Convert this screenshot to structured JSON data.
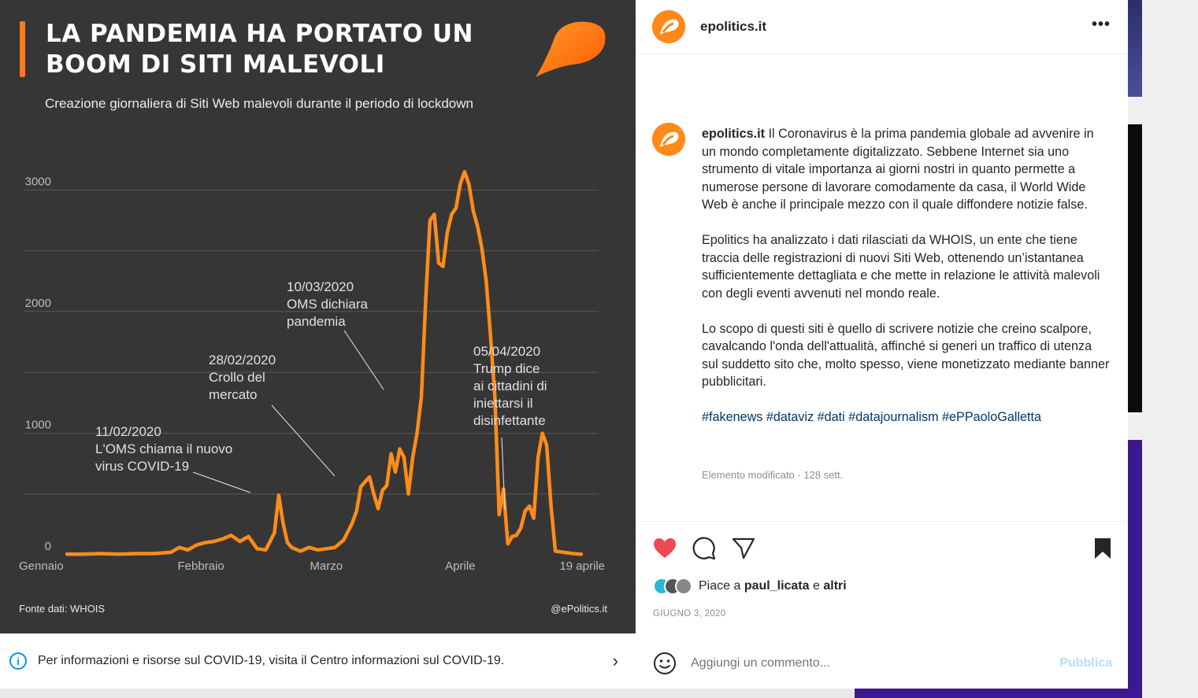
{
  "post": {
    "title_line1": "LA PANDEMIA HA PORTATO UN",
    "title_line2": "BOOM DI SITI MALEVOLI",
    "subtitle": "Creazione giornaliera di Siti Web malevoli durante il periodo di lockdown",
    "source": "Fonte dati: WHOIS",
    "handle": "@ePolitics.it",
    "accent_color": "#ff7a1a",
    "line_color": "#ff8c1a",
    "bg_color": "#363636"
  },
  "chart_data": {
    "type": "line",
    "title": "LA PANDEMIA HA PORTATO UN BOOM DI SITI MALEVOLI",
    "subtitle": "Creazione giornaliera di Siti Web malevoli durante il periodo di lockdown",
    "xlabel": "",
    "ylabel": "",
    "ylim": [
      0,
      3300
    ],
    "y_ticks": [
      0,
      1000,
      2000,
      3000
    ],
    "y_tick_labels": [
      "0",
      "1000",
      "2000",
      "3000"
    ],
    "x_ticks": [
      {
        "label": "Gennaio",
        "day": 0
      },
      {
        "label": "Febbraio",
        "day": 31
      },
      {
        "label": "Marzo",
        "day": 60
      },
      {
        "label": "Aprile",
        "day": 91
      },
      {
        "label": "19 aprile",
        "day": 109
      }
    ],
    "grid": true,
    "series": [
      {
        "values": [
          [
            0,
            5
          ],
          [
            4,
            5
          ],
          [
            8,
            10
          ],
          [
            12,
            5
          ],
          [
            16,
            10
          ],
          [
            20,
            10
          ],
          [
            24,
            20
          ],
          [
            26,
            60
          ],
          [
            28,
            40
          ],
          [
            30,
            80
          ],
          [
            32,
            100
          ],
          [
            34,
            110
          ],
          [
            36,
            130
          ],
          [
            38,
            160
          ],
          [
            40,
            110
          ],
          [
            42,
            150
          ],
          [
            44,
            50
          ],
          [
            46,
            40
          ],
          [
            48,
            180
          ],
          [
            49,
            490
          ],
          [
            50,
            260
          ],
          [
            51,
            100
          ],
          [
            52,
            60
          ],
          [
            54,
            30
          ],
          [
            56,
            60
          ],
          [
            58,
            40
          ],
          [
            60,
            50
          ],
          [
            62,
            60
          ],
          [
            64,
            120
          ],
          [
            66,
            260
          ],
          [
            67,
            360
          ],
          [
            68,
            560
          ],
          [
            69,
            600
          ],
          [
            70,
            640
          ],
          [
            71,
            500
          ],
          [
            72,
            380
          ],
          [
            73,
            530
          ],
          [
            74,
            570
          ],
          [
            75,
            830
          ],
          [
            76,
            680
          ],
          [
            77,
            870
          ],
          [
            78,
            800
          ],
          [
            79,
            500
          ],
          [
            80,
            800
          ],
          [
            81,
            1000
          ],
          [
            82,
            1300
          ],
          [
            83,
            2100
          ],
          [
            84,
            2750
          ],
          [
            85,
            2800
          ],
          [
            86,
            2400
          ],
          [
            87,
            2370
          ],
          [
            88,
            2650
          ],
          [
            89,
            2800
          ],
          [
            90,
            2850
          ],
          [
            91,
            3050
          ],
          [
            92,
            3150
          ],
          [
            93,
            3050
          ],
          [
            94,
            2830
          ],
          [
            95,
            2700
          ],
          [
            96,
            2520
          ],
          [
            97,
            2250
          ],
          [
            98,
            1800
          ],
          [
            99,
            1300
          ],
          [
            100,
            330
          ],
          [
            101,
            540
          ],
          [
            102,
            90
          ],
          [
            103,
            150
          ],
          [
            104,
            160
          ],
          [
            105,
            220
          ],
          [
            106,
            360
          ],
          [
            107,
            400
          ],
          [
            108,
            300
          ],
          [
            109,
            800
          ],
          [
            110,
            1000
          ],
          [
            111,
            900
          ],
          [
            112,
            400
          ],
          [
            113,
            30
          ],
          [
            115,
            20
          ],
          [
            117,
            10
          ],
          [
            119,
            5
          ]
        ]
      }
    ],
    "annotations": [
      {
        "date": "11/02/2020",
        "text_line1": "L'OMS chiama il nuovo",
        "text_line2": "virus COVID-19",
        "text_line3": ""
      },
      {
        "date": "28/02/2020",
        "text_line1": "Crollo del",
        "text_line2": "mercato",
        "text_line3": ""
      },
      {
        "date": "10/03/2020",
        "text_line1": "OMS dichiara",
        "text_line2": "pandemia",
        "text_line3": ""
      },
      {
        "date": "05/04/2020",
        "text_line1": "Trump dice",
        "text_line2": "ai cittadini di",
        "text_line3": "iniettarsi il",
        "text_line4": "disinfettante"
      }
    ]
  },
  "covid_bar": {
    "text": "Per informazioni e risorse sul COVID-19, visita il Centro informazioni sul COVID-19.",
    "info_icon": "info-icon",
    "chevron_icon": "chevron-right-icon"
  },
  "header": {
    "username": "epolitics.it",
    "more_label": "•••"
  },
  "caption": {
    "username": "epolitics.it",
    "para1": "Il Coronavirus è la prima pandemia globale ad avvenire in un mondo completamente digitalizzato. Sebbene Internet sia uno strumento di vitale importanza ai giorni nostri in quanto permette a numerose persone di lavorare comodamente da casa, il World Wide Web è anche il principale mezzo con il quale diffondere notizie false.",
    "para2": "Epolitics ha analizzato i dati rilasciati da WHOIS, un ente che tiene traccia delle registrazioni di nuovi Siti Web, ottenendo un’istantanea sufficientemente dettagliata e che mette in relazione le attività malevoli con degli eventi avvenuti nel mondo reale.",
    "para3": "Lo scopo di questi siti è quello di scrivere notizie che creino scalpore, cavalcando l'onda dell'attualità, affinché si generi un traffico di utenza sul suddetto sito che, molto spesso, viene monetizzato mediante banner pubblicitari.",
    "tags": "#fakenews #dataviz #dati #datajournalism #ePPaoloGalletta",
    "meta": "Elemento modificato · 128 sett."
  },
  "actions": {
    "like_icon": "heart-filled-icon",
    "comment_icon": "comment-icon",
    "share_icon": "paper-plane-icon",
    "save_icon": "bookmark-filled-icon",
    "like_color": "#ed4956"
  },
  "likes": {
    "prefix": "Piace a",
    "user": "paul_licata",
    "conj": "e",
    "others": "altri"
  },
  "date": "GIUGNO 3, 2020",
  "comment": {
    "placeholder": "Aggiungi un commento...",
    "publish_label": "Pubblica",
    "emoji_icon": "emoji-icon"
  }
}
